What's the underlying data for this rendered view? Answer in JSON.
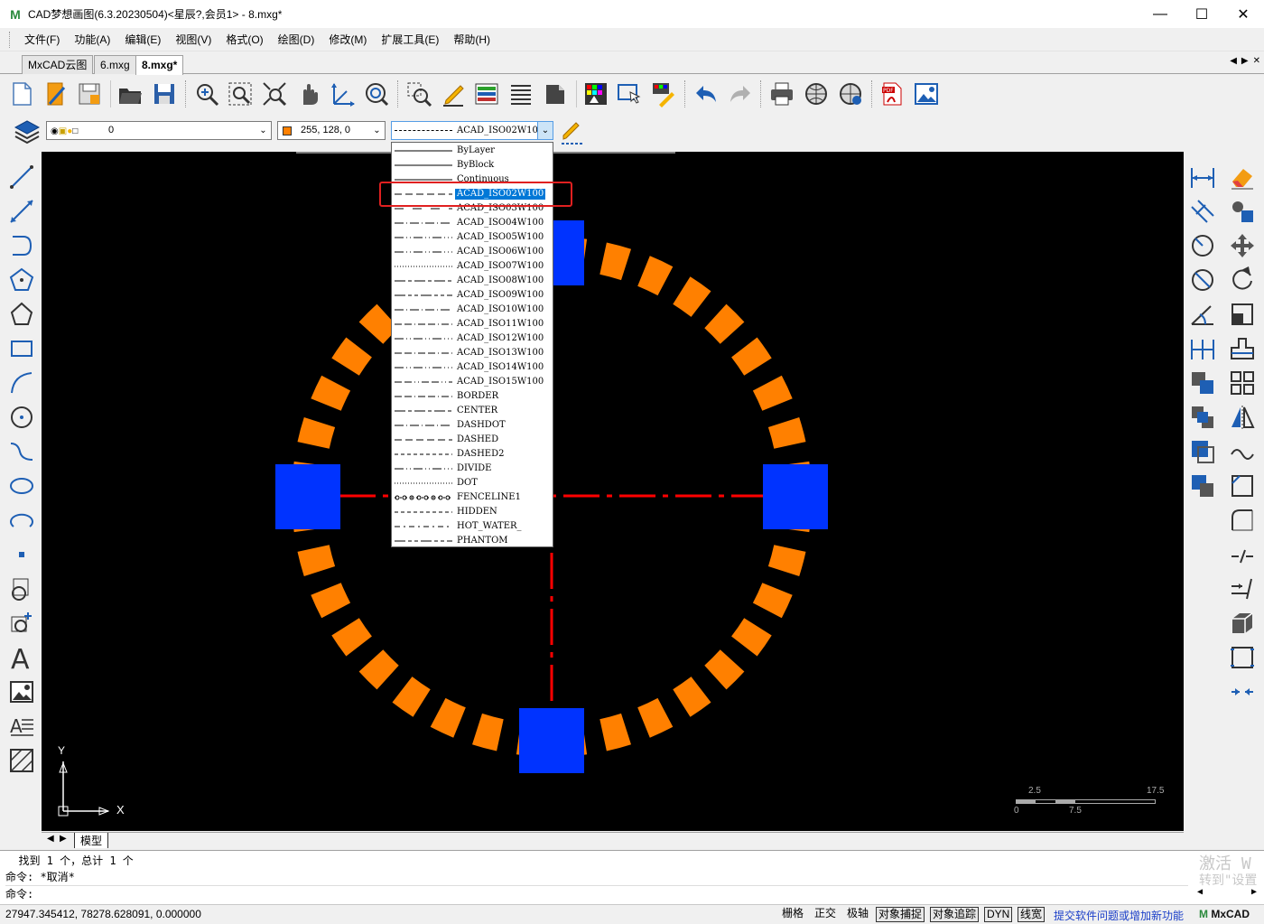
{
  "window": {
    "title": "CAD梦想画图(6.3.20230504)<星辰?,会员1> - 8.mxg*",
    "app_icon": "mxcad-logo-icon",
    "minimize": "—",
    "maximize": "☐",
    "close": "✕"
  },
  "menu": [
    "文件(F)",
    "功能(A)",
    "编辑(E)",
    "视图(V)",
    "格式(O)",
    "绘图(D)",
    "修改(M)",
    "扩展工具(E)",
    "帮助(H)"
  ],
  "tabs": [
    {
      "label": "MxCAD云图",
      "active": false
    },
    {
      "label": "6.mxg",
      "active": false
    },
    {
      "label": "8.mxg*",
      "active": true
    }
  ],
  "tab_nav": {
    "prev": "◀",
    "next": "▶",
    "close": "✕"
  },
  "layer_combo": {
    "value": "0",
    "icons": [
      "eye-icon",
      "unlock-icon",
      "sun-icon",
      "color-square-icon"
    ]
  },
  "color_combo": {
    "value": "255, 128, 0",
    "swatch": "#ff8000"
  },
  "linetype_combo": {
    "value": "ACAD_ISO02W100"
  },
  "linetype_dropdown": {
    "selected_index": 3,
    "items": [
      {
        "label": "ByLayer",
        "pattern": "solid"
      },
      {
        "label": "ByBlock",
        "pattern": "solid"
      },
      {
        "label": "Continuous",
        "pattern": "solid"
      },
      {
        "label": "ACAD_ISO02W100",
        "pattern": "dash"
      },
      {
        "label": "ACAD_ISO03W100",
        "pattern": "longgap"
      },
      {
        "label": "ACAD_ISO04W100",
        "pattern": "dashdot"
      },
      {
        "label": "ACAD_ISO05W100",
        "pattern": "dashdotdot"
      },
      {
        "label": "ACAD_ISO06W100",
        "pattern": "dashdotdot"
      },
      {
        "label": "ACAD_ISO07W100",
        "pattern": "dot"
      },
      {
        "label": "ACAD_ISO08W100",
        "pattern": "longshort"
      },
      {
        "label": "ACAD_ISO09W100",
        "pattern": "longshortshort"
      },
      {
        "label": "ACAD_ISO10W100",
        "pattern": "dashdot"
      },
      {
        "label": "ACAD_ISO11W100",
        "pattern": "dashdashdot"
      },
      {
        "label": "ACAD_ISO12W100",
        "pattern": "dashdotdot"
      },
      {
        "label": "ACAD_ISO13W100",
        "pattern": "dashdashdot"
      },
      {
        "label": "ACAD_ISO14W100",
        "pattern": "dashdotdot"
      },
      {
        "label": "ACAD_ISO15W100",
        "pattern": "dashdashdotdot"
      },
      {
        "label": "BORDER",
        "pattern": "dashdashdot"
      },
      {
        "label": "CENTER",
        "pattern": "longshort"
      },
      {
        "label": "DASHDOT",
        "pattern": "dashdot"
      },
      {
        "label": "DASHED",
        "pattern": "dash"
      },
      {
        "label": "DASHED2",
        "pattern": "shortdash"
      },
      {
        "label": "DIVIDE",
        "pattern": "dashdotdot"
      },
      {
        "label": "DOT",
        "pattern": "dot"
      },
      {
        "label": "FENCELINE1",
        "pattern": "circles"
      },
      {
        "label": "HIDDEN",
        "pattern": "shortdash"
      },
      {
        "label": "HOT_WATER_",
        "pattern": "hotwater"
      },
      {
        "label": "PHANTOM",
        "pattern": "longshortshort"
      }
    ]
  },
  "drawing": {
    "ring_color": "#ff8000",
    "block_color": "#0033ff",
    "centerline_color": "#ff0000",
    "background": "#000000"
  },
  "axis": {
    "x_label": "X",
    "y_label": "Y"
  },
  "scale_bar": {
    "labels": [
      "2.5",
      "17.5",
      "0",
      "7.5"
    ]
  },
  "model_tab": "模型",
  "command_lines": [
    "  找到 1 个，总计 1 个",
    "命令: *取消*",
    "命令:"
  ],
  "watermark": [
    "激活 W",
    "转到\"设置"
  ],
  "status": {
    "coords": "27947.345412,  78278.628091,  0.000000",
    "toggles": [
      {
        "label": "栅格",
        "on": false
      },
      {
        "label": "正交",
        "on": false
      },
      {
        "label": "极轴",
        "on": false
      },
      {
        "label": "对象捕捉",
        "on": true
      },
      {
        "label": "对象追踪",
        "on": true
      },
      {
        "label": "DYN",
        "on": true
      },
      {
        "label": "线宽",
        "on": true
      }
    ],
    "link": "提交软件问题或增加新功能",
    "logo": "MxCAD"
  }
}
